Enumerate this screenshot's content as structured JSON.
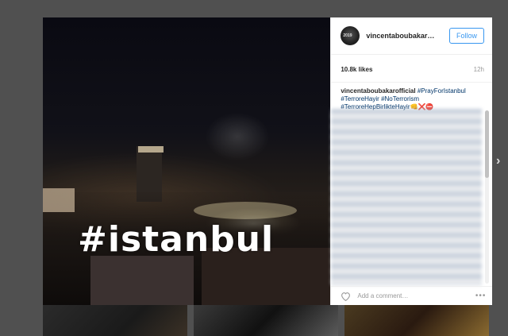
{
  "post": {
    "overlay_text": "#istanbul",
    "username": "vincentaboubakar…",
    "avatar_text": "2019",
    "follow_label": "Follow",
    "likes": "10.8k likes",
    "time": "12h",
    "caption": {
      "user": "vincentaboubakarofficial",
      "tags": [
        "#PrayForIstanbul",
        "#TerroreHayir",
        "#NoTerrorism",
        "#TerroreHepBirlikteHayir"
      ],
      "emoji": "👊❌⛔"
    },
    "comment_placeholder": "Add a comment…",
    "more_label": "•••"
  },
  "nav": {
    "next_arrow": "›"
  }
}
